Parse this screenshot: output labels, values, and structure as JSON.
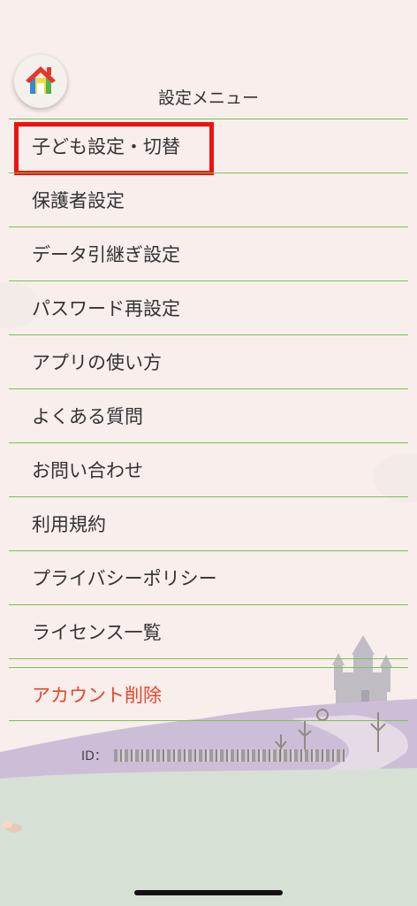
{
  "header": {
    "title": "設定メニュー"
  },
  "home_button": {
    "icon": "house-icon"
  },
  "menu": {
    "items": [
      {
        "label": "子ども設定・切替"
      },
      {
        "label": "保護者設定"
      },
      {
        "label": "データ引継ぎ設定"
      },
      {
        "label": "パスワード再設定"
      },
      {
        "label": "アプリの使い方"
      },
      {
        "label": "よくある質問"
      },
      {
        "label": "お問い合わせ"
      },
      {
        "label": "利用規約"
      },
      {
        "label": "プライバシーポリシー"
      },
      {
        "label": "ライセンス一覧"
      }
    ],
    "delete_account": {
      "label": "アカウント削除"
    }
  },
  "account": {
    "id_label": "ID："
  },
  "colors": {
    "background": "#f8eeec",
    "divider": "#7cc054",
    "danger_text": "#e8452c",
    "highlight_border": "#ee1111",
    "ground": "#d7e0d5",
    "hill": "#cdbed8"
  }
}
